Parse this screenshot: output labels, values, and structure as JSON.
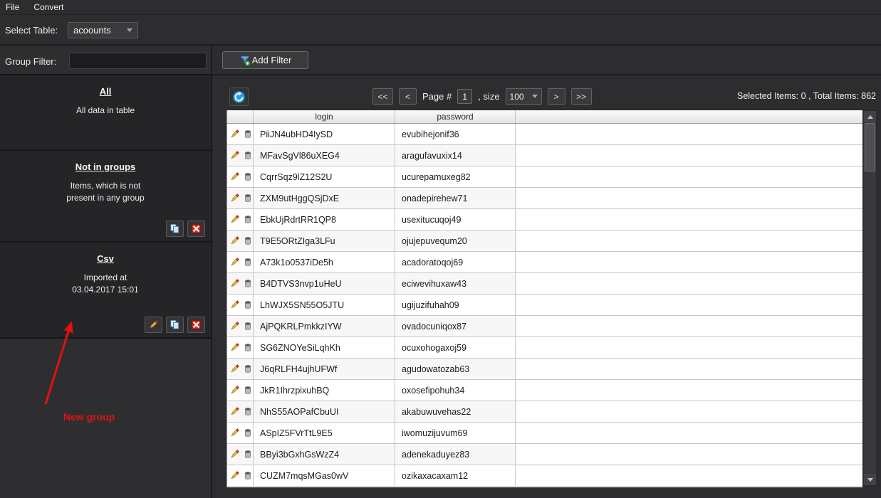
{
  "menu": {
    "items": [
      {
        "label": "File"
      },
      {
        "label": "Convert"
      }
    ]
  },
  "table_select": {
    "label": "Select Table:",
    "value": "acoounts"
  },
  "group_filter": {
    "label": "Group Filter:",
    "value": ""
  },
  "groups": [
    {
      "title": "All",
      "desc": "All data in table"
    },
    {
      "title": "Not in groups",
      "desc": "Items, which is not\npresent in any group"
    },
    {
      "title": "Csv",
      "desc": "Imported at\n03.04.2017 15:01"
    }
  ],
  "annotation": {
    "label": "New group",
    "color": "#e01212"
  },
  "filter_toolbar": {
    "add_filter_label": "Add Filter"
  },
  "pagination": {
    "first": "<<",
    "prev": "<",
    "page_label": "Page #",
    "page": "1",
    "size_label": ", size",
    "size": "100",
    "next": ">",
    "last": ">>"
  },
  "status": {
    "text": "Selected Items: 0 , Total Items: 862"
  },
  "grid": {
    "columns": [
      "login",
      "password"
    ],
    "rows": [
      {
        "login": "PiiJN4ubHD4IySD",
        "password": "evubihejonif36"
      },
      {
        "login": "MFavSgVl86uXEG4",
        "password": "aragufavuxix14"
      },
      {
        "login": "CqrrSqz9lZ12S2U",
        "password": "ucurepamuxeg82"
      },
      {
        "login": "ZXM9utHggQSjDxE",
        "password": "onadepirehew71"
      },
      {
        "login": "EbkUjRdrtRR1QP8",
        "password": "usexitucuqoj49"
      },
      {
        "login": "T9E5ORtZIga3LFu",
        "password": "ojujepuvequm20"
      },
      {
        "login": "A73k1o0537iDe5h",
        "password": "acadoratoqoj69"
      },
      {
        "login": "B4DTVS3nvp1uHeU",
        "password": "eciwevihuxaw43"
      },
      {
        "login": "LhWJX5SN55O5JTU",
        "password": "ugijuzifuhah09"
      },
      {
        "login": "AjPQKRLPmkkzIYW",
        "password": "ovadocuniqox87"
      },
      {
        "login": "SG6ZNOYeSiLqhKh",
        "password": "ocuxohogaxoj59"
      },
      {
        "login": "J6qRLFH4ujhUFWf",
        "password": "agudowatozab63"
      },
      {
        "login": "JkR1IhrzpixuhBQ",
        "password": "oxosefipohuh34"
      },
      {
        "login": "NhS55AOPafCbuUI",
        "password": "akabuwuvehas22"
      },
      {
        "login": "ASpIZ5FVrTtL9E5",
        "password": "iwomuzijuvum69"
      },
      {
        "login": "BByi3bGxhGsWzZ4",
        "password": "adenekaduyez83"
      },
      {
        "login": "CUZM7mqsMGas0wV",
        "password": "ozikaxacaxam12"
      }
    ]
  }
}
